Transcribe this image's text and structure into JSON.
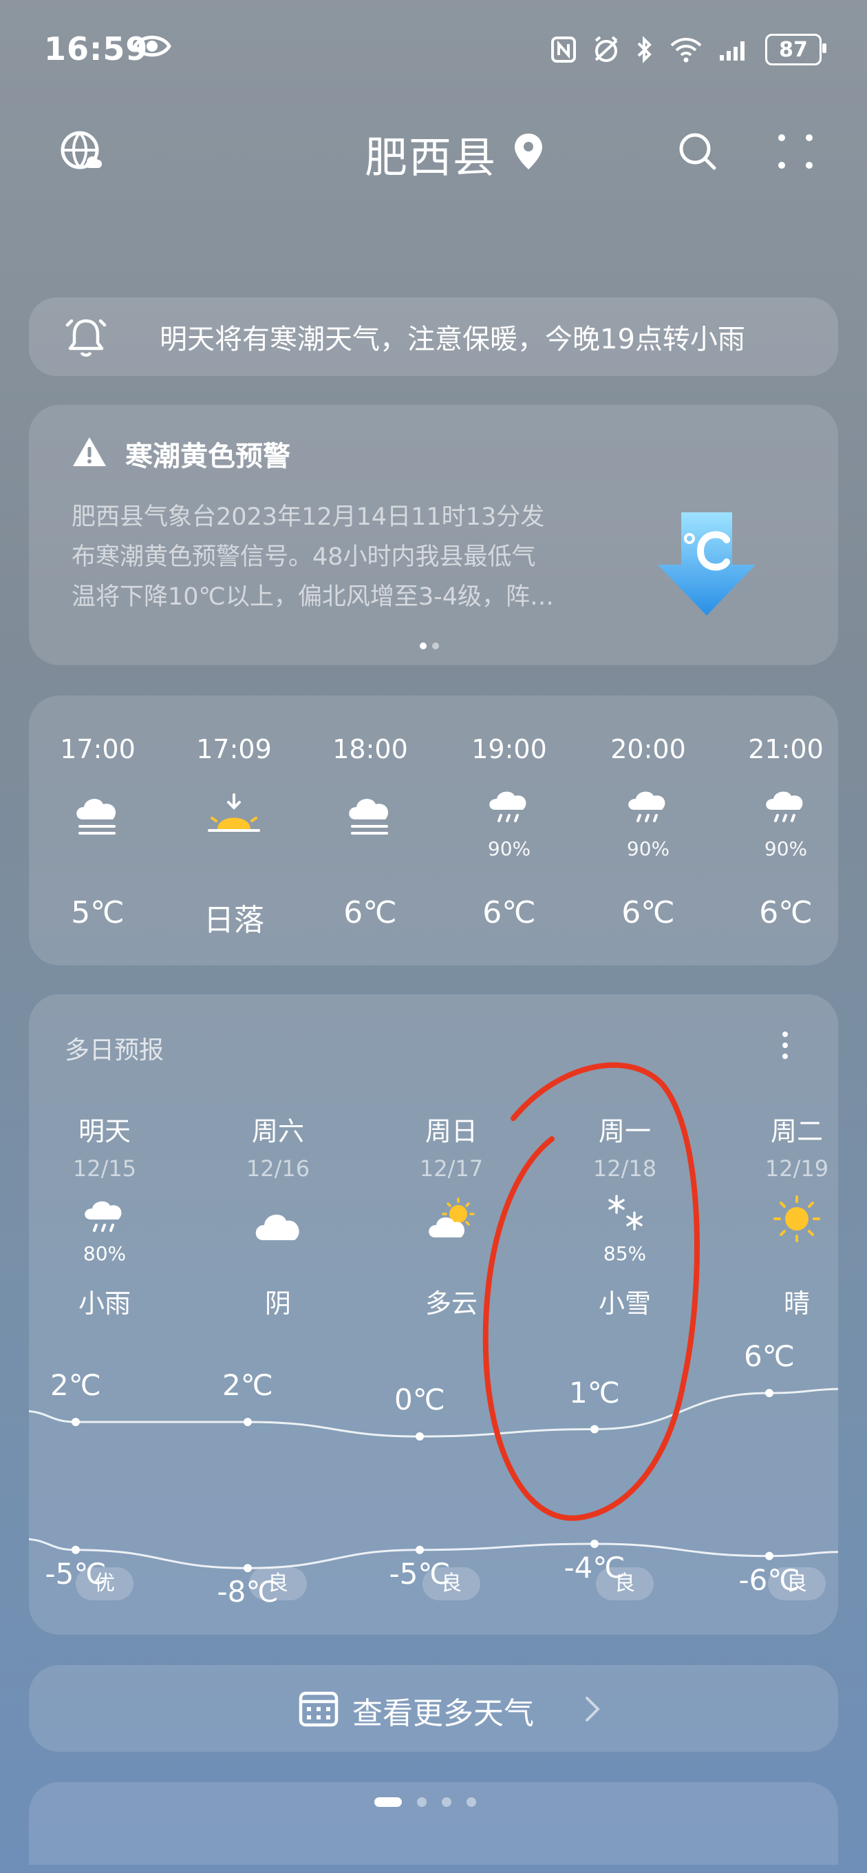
{
  "status_bar": {
    "time": "16:59",
    "battery": "87"
  },
  "header": {
    "city": "肥西县"
  },
  "notice": {
    "text": "明天将有寒潮天气，注意保暖，今晚19点转小雨"
  },
  "alert": {
    "title": "寒潮黄色预警",
    "lines": [
      "肥西县气象台2023年12月14日11时13分发",
      "布寒潮黄色预警信号。48小时内我县最低气",
      "温将下降10℃以上，偏北风增至3-4级，阵…"
    ],
    "page_count": 2,
    "page_index": 0
  },
  "hourly": [
    {
      "time": "17:00",
      "icon": "cloudy-fog-icon",
      "precip": "",
      "temp": "5℃"
    },
    {
      "time": "17:09",
      "icon": "sunset-icon",
      "precip": "",
      "temp": "日落"
    },
    {
      "time": "18:00",
      "icon": "cloudy-fog-icon",
      "precip": "",
      "temp": "6℃"
    },
    {
      "time": "19:00",
      "icon": "light-rain-icon",
      "precip": "90%",
      "temp": "6℃"
    },
    {
      "time": "20:00",
      "icon": "light-rain-icon",
      "precip": "90%",
      "temp": "6℃"
    },
    {
      "time": "21:00",
      "icon": "light-rain-icon",
      "precip": "90%",
      "temp": "6℃"
    }
  ],
  "daily": {
    "title": "多日预报",
    "days": [
      {
        "day": "明天",
        "date": "12/15",
        "icon": "light-rain-icon",
        "precip": "80%",
        "condition": "小雨",
        "high": "2℃",
        "low": "-5℃",
        "aqi": "优"
      },
      {
        "day": "周六",
        "date": "12/16",
        "icon": "overcast-icon",
        "precip": "",
        "condition": "阴",
        "high": "2℃",
        "low": "-8℃",
        "aqi": "良"
      },
      {
        "day": "周日",
        "date": "12/17",
        "icon": "partly-cloudy-icon",
        "precip": "",
        "condition": "多云",
        "high": "0℃",
        "low": "-5℃",
        "aqi": "良"
      },
      {
        "day": "周一",
        "date": "12/18",
        "icon": "snow-icon",
        "precip": "85%",
        "condition": "小雪",
        "high": "1℃",
        "low": "-4℃",
        "aqi": "良"
      },
      {
        "day": "周二",
        "date": "12/19",
        "icon": "sunny-icon",
        "precip": "",
        "condition": "晴",
        "high": "6℃",
        "low": "-6℃",
        "aqi": "良"
      }
    ],
    "high_values": [
      2,
      2,
      0,
      1,
      6
    ],
    "low_values": [
      -5,
      -8,
      -5,
      -4,
      -6
    ]
  },
  "more_button": {
    "label": "查看更多天气"
  },
  "pager": {
    "count": 4,
    "active": 0
  },
  "colors": {
    "annotation": "#e8361e"
  }
}
